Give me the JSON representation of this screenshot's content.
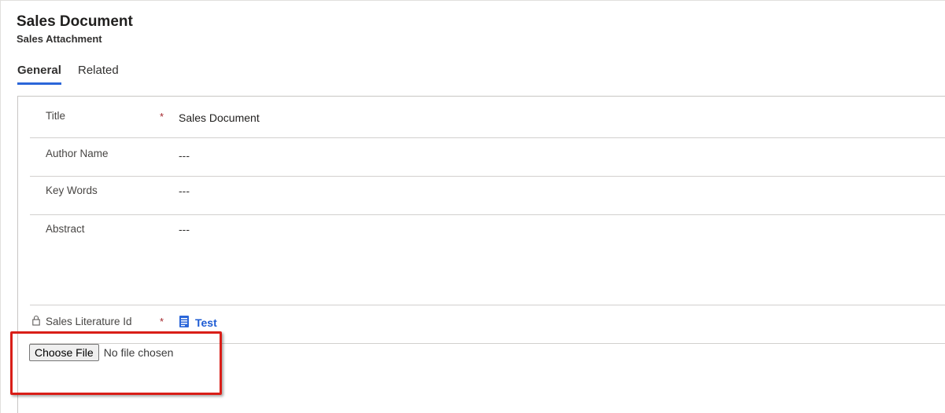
{
  "header": {
    "title": "Sales Document",
    "subtitle": "Sales Attachment"
  },
  "tabs": [
    {
      "label": "General",
      "active": true
    },
    {
      "label": "Related",
      "active": false
    }
  ],
  "form": {
    "fields": [
      {
        "label": "Title",
        "required": "*",
        "value": "Sales Document"
      },
      {
        "label": "Author Name",
        "value": "---"
      },
      {
        "label": "Key Words",
        "value": "---"
      },
      {
        "label": "Abstract",
        "value": "---"
      },
      {
        "label": "Sales Literature Id",
        "required": "*",
        "value": "Test",
        "locked": true
      }
    ]
  },
  "file_input": {
    "button_label": "Choose File",
    "status": "No file chosen"
  },
  "colors": {
    "accent": "#2b66d9",
    "required": "#a4262c",
    "link": "#1d5bd3",
    "highlight": "#d91e18"
  }
}
